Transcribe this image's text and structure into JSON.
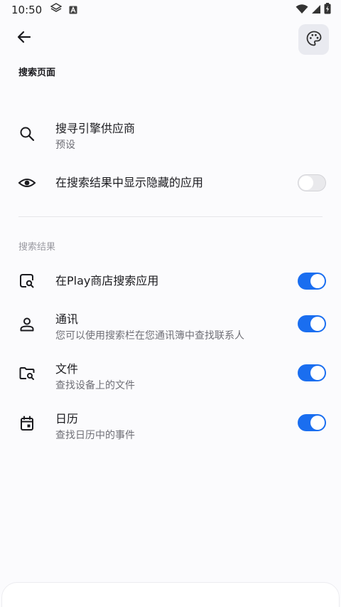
{
  "status_bar": {
    "time": "10:50"
  },
  "page": {
    "title": "搜索页面"
  },
  "settings": [
    {
      "title": "搜寻引擎供应商",
      "subtitle": "预设"
    },
    {
      "title": "在搜索结果中显示隐藏的应用",
      "toggle": false
    }
  ],
  "section_header": "搜索结果",
  "results": [
    {
      "title": "在Play商店搜索应用",
      "toggle": true
    },
    {
      "title": "通讯",
      "subtitle": "您可以使用搜索栏在您通讯簿中查找联系人",
      "toggle": true
    },
    {
      "title": "文件",
      "subtitle": "查找设备上的文件",
      "toggle": true
    },
    {
      "title": "日历",
      "subtitle": "查找日历中的事件",
      "toggle": true
    }
  ],
  "colors": {
    "accent": "#1a6ef0",
    "background": "#fbfbfd"
  },
  "icons": [
    "back-arrow-icon",
    "palette-icon",
    "search-icon",
    "eye-icon",
    "play-search-icon",
    "person-icon",
    "folder-search-icon",
    "calendar-icon"
  ]
}
